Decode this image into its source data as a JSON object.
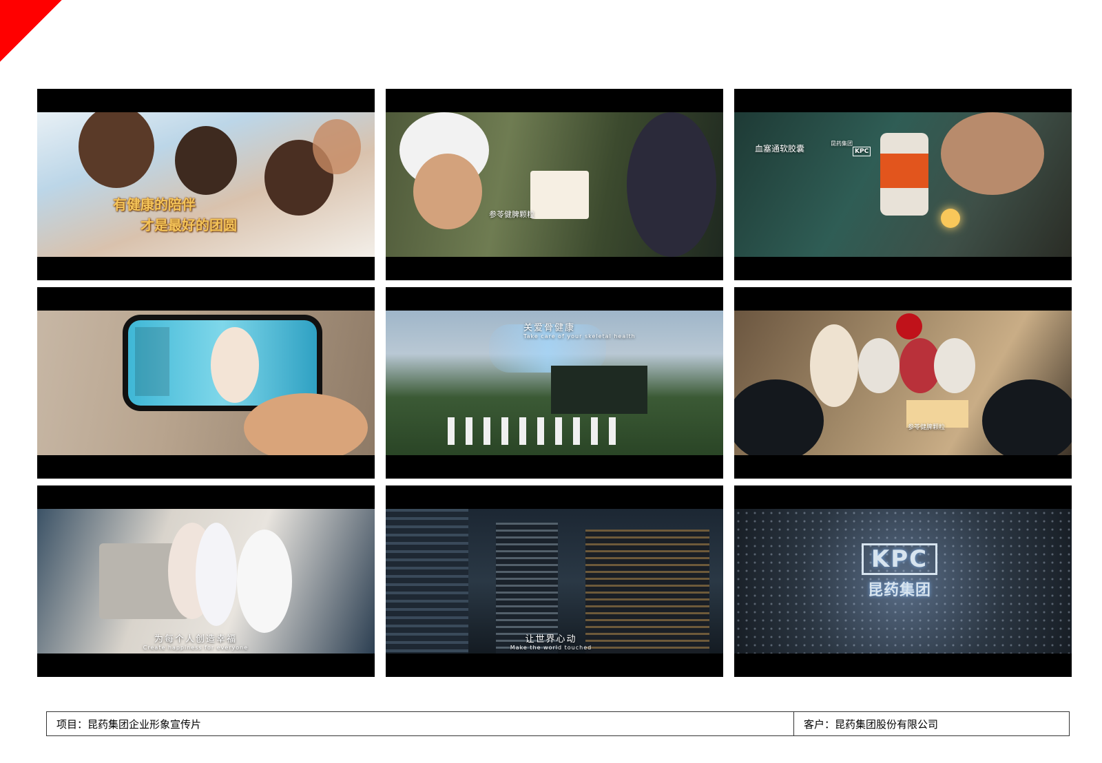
{
  "frames": [
    {
      "name": "frame-1-family-waving",
      "caption_line1": "有健康的陪伴",
      "caption_line2": "才是最好的团圆"
    },
    {
      "name": "frame-2-delivery-rider",
      "product_label": "参苓健脾颗粒"
    },
    {
      "name": "frame-3-product-bottle",
      "product_title": "血塞通软胶囊",
      "brand_tag": "昆药集团",
      "logo_text": "KPC"
    },
    {
      "name": "frame-4-livestream-phone"
    },
    {
      "name": "frame-5-tai-chi",
      "caption_cn": "关爱骨健康",
      "caption_en": "Take care of your skeletal health"
    },
    {
      "name": "frame-6-family-dinner",
      "product_label": "参苓健脾颗粒"
    },
    {
      "name": "frame-7-family-home",
      "caption_cn": "为每个人创造幸福",
      "caption_en": "Create happiness for everyone"
    },
    {
      "name": "frame-8-city-night",
      "caption_cn": "让世界心动",
      "caption_en": "Make the world touched"
    },
    {
      "name": "frame-9-kpc-logo",
      "logo_mark": "KPC",
      "logo_name": "昆药集团"
    }
  ],
  "footer": {
    "project": "项目：昆药集团企业形象宣传片",
    "client": "客户：昆药集团股份有限公司"
  },
  "colors": {
    "accent": "#ff0000",
    "gold": "#f4c45a"
  }
}
